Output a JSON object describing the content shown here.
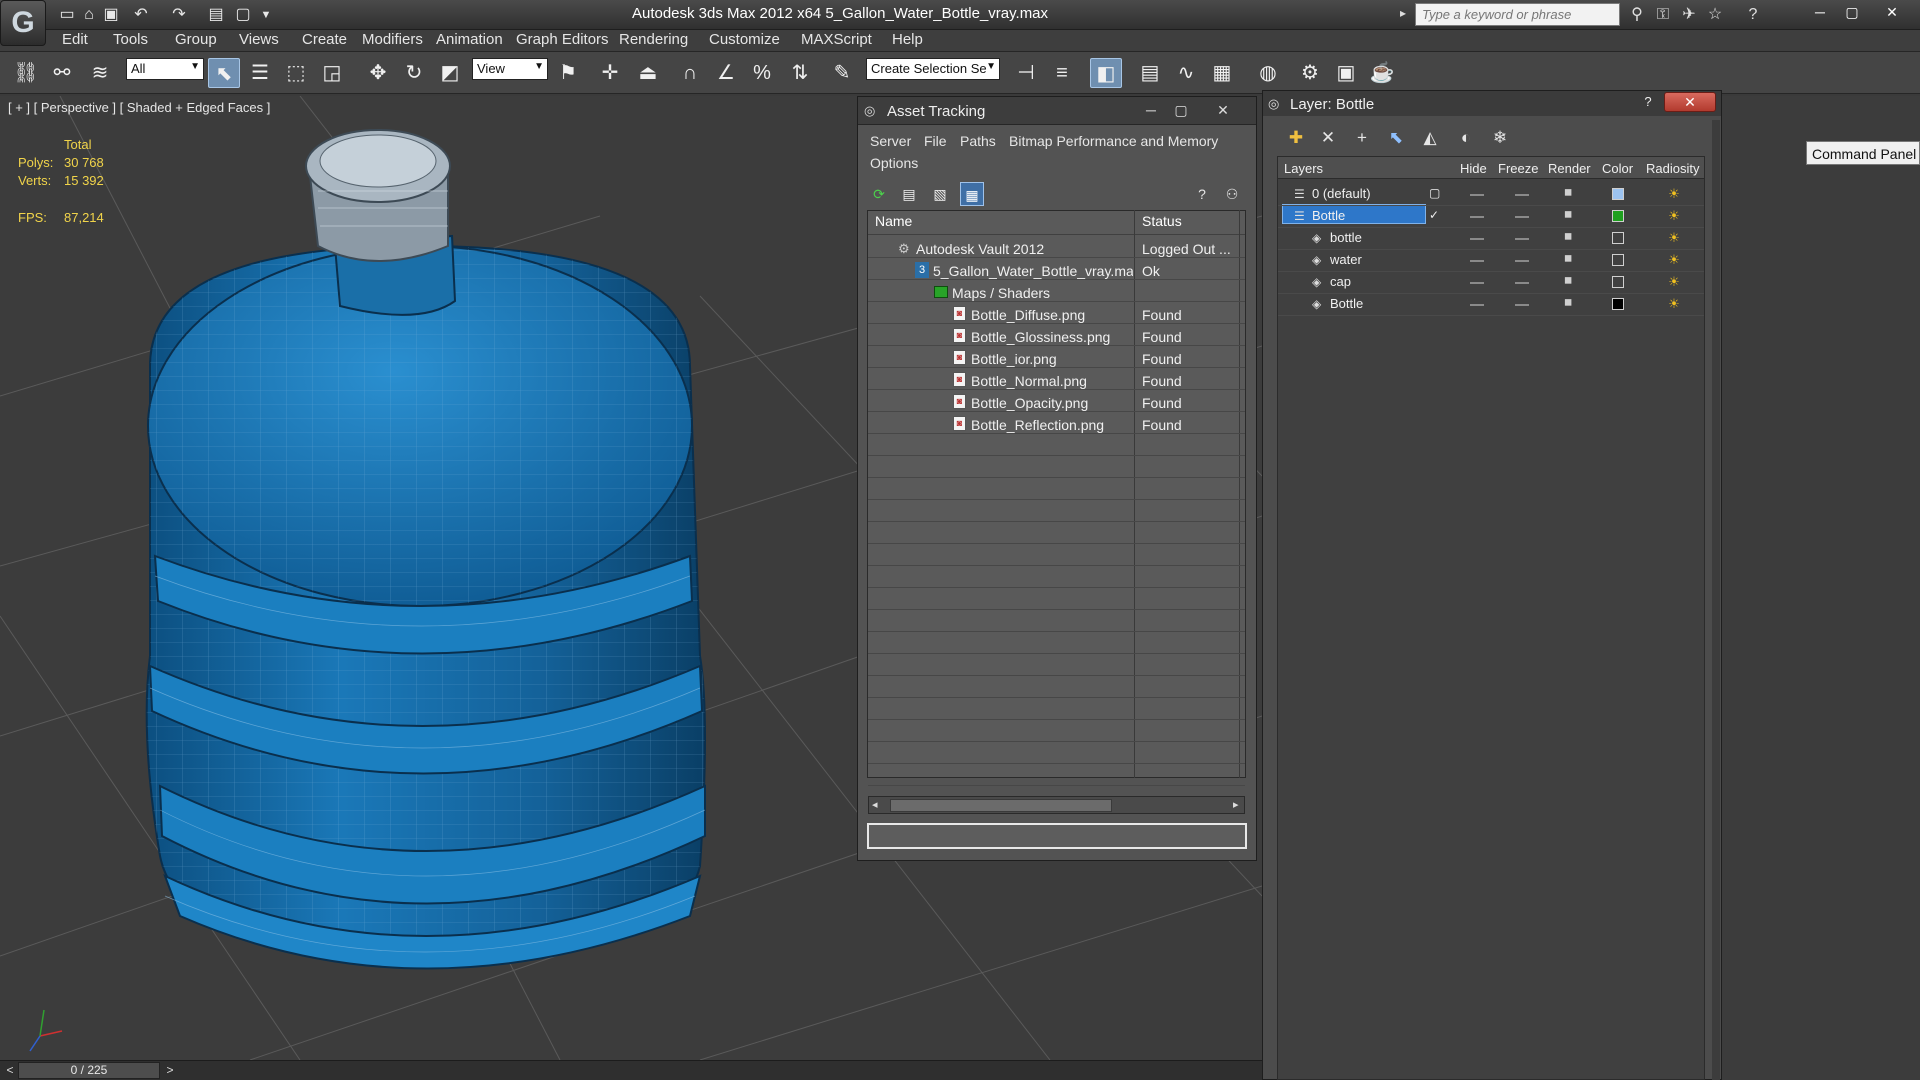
{
  "app": {
    "title": "Autodesk 3ds Max  2012 x64     5_Gallon_Water_Bottle_vray.max",
    "search_placeholder": "Type a keyword or phrase",
    "logo_glyph": "G"
  },
  "menu": [
    "Edit",
    "Tools",
    "Group",
    "Views",
    "Create",
    "Modifiers",
    "Animation",
    "Graph Editors",
    "Rendering",
    "Customize",
    "MAXScript",
    "Help"
  ],
  "toolbar": {
    "selection_filter": "All",
    "reference_coord": "View",
    "named_selection": "Create Selection Se"
  },
  "viewport": {
    "label": "[ + ] [ Perspective ] [ Shaded + Edged Faces ]",
    "stats": {
      "total_label": "Total",
      "polys_label": "Polys:",
      "polys_value": "30 768",
      "verts_label": "Verts:",
      "verts_value": "15 392",
      "fps_label": "FPS:",
      "fps_value": "87,214"
    }
  },
  "timeline": {
    "slider": "0 / 225",
    "prev": "<",
    "next": ">"
  },
  "asset_tracking": {
    "title": "Asset Tracking",
    "menu": [
      "Server",
      "File",
      "Paths",
      "Bitmap Performance and Memory",
      "Options"
    ],
    "columns": [
      "Name",
      "Status"
    ],
    "rows": [
      {
        "name": "Autodesk Vault 2012",
        "status": "Logged Out ..."
      },
      {
        "name": "5_Gallon_Water_Bottle_vray.max",
        "status": "Ok"
      },
      {
        "name": "Maps / Shaders",
        "status": ""
      },
      {
        "name": "Bottle_Diffuse.png",
        "status": "Found"
      },
      {
        "name": "Bottle_Glossiness.png",
        "status": "Found"
      },
      {
        "name": "Bottle_ior.png",
        "status": "Found"
      },
      {
        "name": "Bottle_Normal.png",
        "status": "Found"
      },
      {
        "name": "Bottle_Opacity.png",
        "status": "Found"
      },
      {
        "name": "Bottle_Reflection.png",
        "status": "Found"
      }
    ]
  },
  "layer_window": {
    "title": "Layer: Bottle",
    "columns": {
      "layers": "Layers",
      "hide": "Hide",
      "freeze": "Freeze",
      "render": "Render",
      "color": "Color",
      "radiosity": "Radiosity"
    },
    "rows": [
      {
        "name": "0 (default)",
        "color": "#9cc3f0"
      },
      {
        "name": "Bottle",
        "color": "#1fa01f"
      },
      {
        "name": "bottle",
        "color": "#404040"
      },
      {
        "name": "water",
        "color": "#404040"
      },
      {
        "name": "cap",
        "color": "#404040"
      },
      {
        "name": "Bottle",
        "color": "#000000"
      }
    ]
  },
  "command_panel": "Command Panel",
  "colors": {
    "bottle_blue": "#1a6fa8",
    "selection_blue": "#2e77c9",
    "stat_yellow": "#f1d44a"
  }
}
